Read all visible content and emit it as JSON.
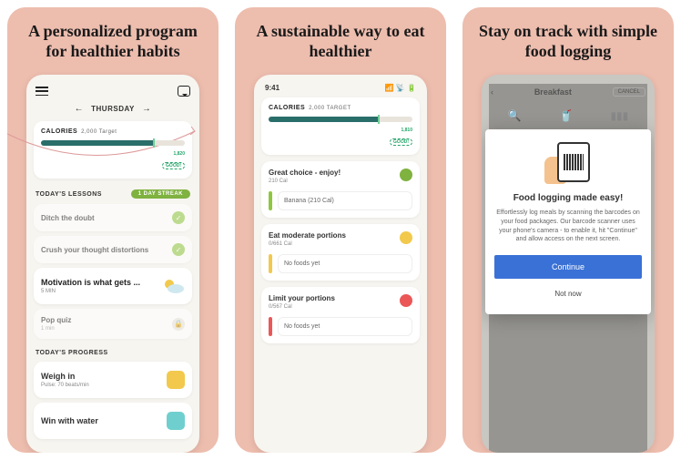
{
  "panels": [
    {
      "headline": "A personalized program for healthier habits"
    },
    {
      "headline": "A sustainable way to eat healthier"
    },
    {
      "headline": "Stay on track with simple food logging"
    }
  ],
  "phone1": {
    "day": "THURSDAY",
    "calories_label": "CALORIES",
    "calories_target": "2,000 Target",
    "cal_value": "1,820",
    "cal_status": "GOOD!",
    "section_lessons": "TODAY'S LESSONS",
    "streak": "1 DAY STREAK",
    "lessons": [
      {
        "title": "Ditch the doubt",
        "done": true
      },
      {
        "title": "Crush your thought distortions",
        "done": true
      },
      {
        "title": "Motivation is what gets ...",
        "sub": "5 MIN",
        "active": true
      },
      {
        "title": "Pop quiz",
        "sub": "1 min",
        "locked": true
      }
    ],
    "section_progress": "TODAY'S PROGRESS",
    "progress": [
      {
        "title": "Weigh in",
        "sub": "Pulse: 70 beats/min"
      },
      {
        "title": "Win with water"
      }
    ]
  },
  "phone2": {
    "time": "9:41",
    "calories_label": "CALORIES",
    "calories_target": "2,000 TARGET",
    "cal_value": "1,810",
    "cal_status": "GOOD!",
    "cards": [
      {
        "title": "Great choice - enjoy!",
        "sub": "210 Cal",
        "color": "green",
        "item": "Banana (210 Cal)"
      },
      {
        "title": "Eat moderate portions",
        "sub": "0/661 Cal",
        "color": "yellow",
        "item": "No foods yet"
      },
      {
        "title": "Limit your portions",
        "sub": "0/567 Cal",
        "color": "red",
        "item": "No foods yet"
      }
    ]
  },
  "phone3": {
    "header_title": "Breakfast",
    "cancel": "CANCEL",
    "modal": {
      "title": "Food logging made easy!",
      "body": "Effortlessly log meals by scanning the barcodes on your food packages. Our barcode scanner uses your phone's camera - to enable it, hit \"Continue\" and allow access on the next screen.",
      "primary": "Continue",
      "secondary": "Not now"
    }
  }
}
